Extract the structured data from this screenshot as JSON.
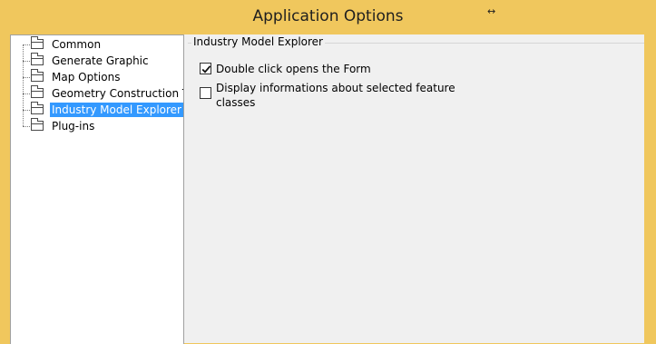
{
  "window": {
    "title": "Application Options",
    "resize_glyph": "↔"
  },
  "tree": {
    "items": [
      {
        "label": "Common",
        "icon": "folder-icon",
        "selected": false
      },
      {
        "label": "Generate Graphic",
        "icon": "folder-icon",
        "selected": false
      },
      {
        "label": "Map Options",
        "icon": "folder-icon",
        "selected": false
      },
      {
        "label": "Geometry Construction T",
        "icon": "folder-icon",
        "selected": false
      },
      {
        "label": "Industry Model Explorer",
        "icon": "folder-icon",
        "selected": true
      },
      {
        "label": "Plug-ins",
        "icon": "folder-icon",
        "selected": false
      }
    ]
  },
  "content": {
    "group_title": "Industry Model Explorer",
    "options": [
      {
        "label": "Double click opens the Form",
        "checked": true
      },
      {
        "label": "Display informations about selected feature classes",
        "checked": false
      }
    ]
  },
  "colors": {
    "frame": "#f0c75d",
    "selection": "#3399ff",
    "panel": "#f0f0f0"
  }
}
